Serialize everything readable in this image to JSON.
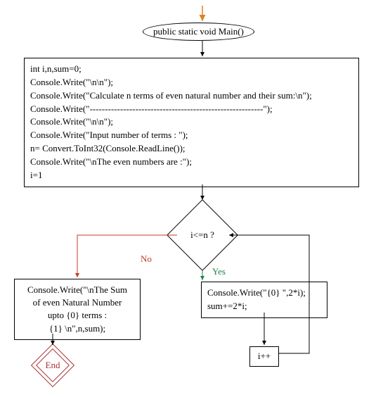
{
  "nodes": {
    "start": {
      "label": "public static void Main()"
    },
    "init": {
      "lines": [
        "int i,n,sum=0;",
        "Console.Write(\"\\n\\n\");",
        "Console.Write(\"Calculate n terms of even natural number and their sum:\\n\");",
        "Console.Write(\"---------------------------------------------------------\");",
        "Console.Write(\"\\n\\n\");",
        "Console.Write(\"Input number of terms : \");",
        "n= Convert.ToInt32(Console.ReadLine());",
        "Console.Write(\"\\nThe even numbers are :\");",
        "i=1"
      ]
    },
    "cond": {
      "label": "i<=n ?"
    },
    "loop_body": {
      "lines": [
        "Console.Write(\"{0} \",2*i);",
        "sum+=2*i;"
      ]
    },
    "incr": {
      "label": "i++"
    },
    "result": {
      "lines": [
        "Console.Write(\"\\nThe Sum",
        "of even Natural Number",
        "upto {0} terms :",
        "{1} \\n\",n,sum);"
      ]
    },
    "end": {
      "label": "End"
    }
  },
  "edges": {
    "no": {
      "label": "No",
      "color": "#c0392b"
    },
    "yes": {
      "label": "Yes",
      "color": "#1e8449"
    }
  },
  "colors": {
    "entry_arrow": "#e08020",
    "default_arrow": "#000000",
    "end_stroke": "#a33"
  }
}
